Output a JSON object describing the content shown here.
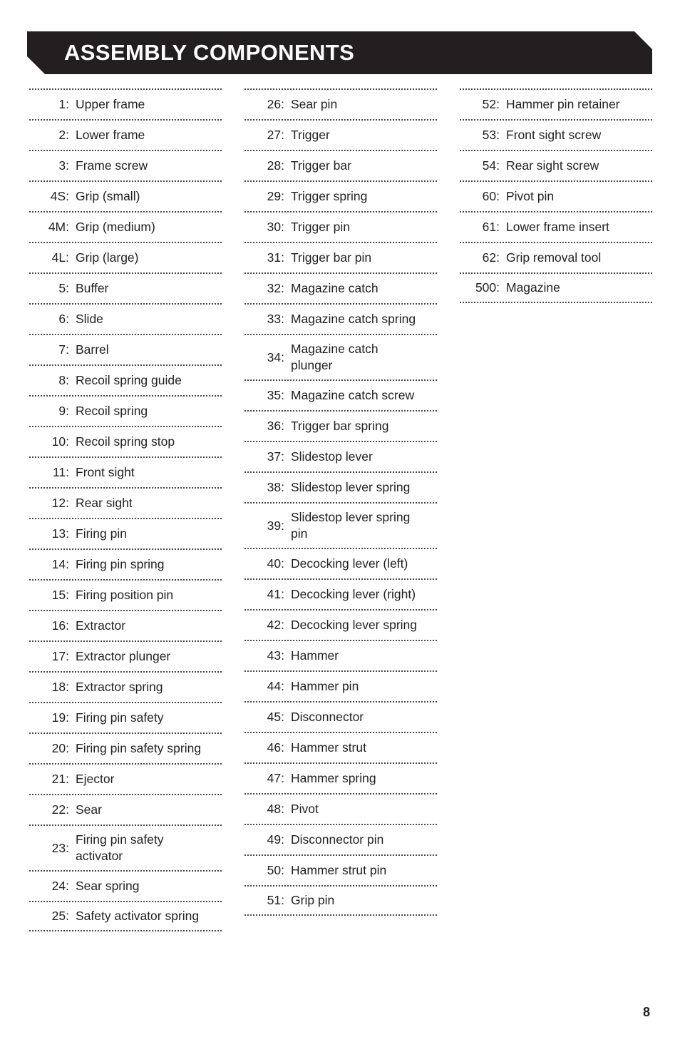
{
  "header": {
    "title": "ASSEMBLY COMPONENTS",
    "background_color": "#231f20",
    "text_color": "#ffffff"
  },
  "footer": {
    "page_number": "8"
  },
  "columns": [
    {
      "id": "column-1",
      "rows": [
        {
          "num": "1:",
          "label": "Upper frame"
        },
        {
          "num": "2:",
          "label": "Lower frame"
        },
        {
          "num": "3:",
          "label": "Frame screw"
        },
        {
          "num": "4S:",
          "label": "Grip (small)"
        },
        {
          "num": "4M:",
          "label": "Grip (medium)"
        },
        {
          "num": "4L:",
          "label": "Grip (large)"
        },
        {
          "num": "5:",
          "label": "Buffer"
        },
        {
          "num": "6:",
          "label": "Slide"
        },
        {
          "num": "7:",
          "label": "Barrel"
        },
        {
          "num": "8:",
          "label": "Recoil spring guide"
        },
        {
          "num": "9:",
          "label": "Recoil spring"
        },
        {
          "num": "10:",
          "label": "Recoil spring stop"
        },
        {
          "num": "11:",
          "label": "Front sight"
        },
        {
          "num": "12:",
          "label": "Rear sight"
        },
        {
          "num": "13:",
          "label": "Firing pin"
        },
        {
          "num": "14:",
          "label": "Firing pin spring"
        },
        {
          "num": "15:",
          "label": "Firing position pin"
        },
        {
          "num": "16:",
          "label": "Extractor"
        },
        {
          "num": "17:",
          "label": "Extractor plunger"
        },
        {
          "num": "18:",
          "label": "Extractor spring"
        },
        {
          "num": "19:",
          "label": "Firing pin safety"
        },
        {
          "num": "20:",
          "label": "Firing pin safety spring"
        },
        {
          "num": "21:",
          "label": "Ejector"
        },
        {
          "num": "22:",
          "label": "Sear"
        },
        {
          "num": "23:",
          "label": "Firing pin safety activator",
          "two_line": true
        },
        {
          "num": "24:",
          "label": "Sear spring"
        },
        {
          "num": "25:",
          "label": "Safety activator spring"
        }
      ]
    },
    {
      "id": "column-2",
      "rows": [
        {
          "num": "26:",
          "label": "Sear pin"
        },
        {
          "num": "27:",
          "label": "Trigger"
        },
        {
          "num": "28:",
          "label": "Trigger bar"
        },
        {
          "num": "29:",
          "label": "Trigger spring"
        },
        {
          "num": "30:",
          "label": "Trigger pin"
        },
        {
          "num": "31:",
          "label": "Trigger bar pin"
        },
        {
          "num": "32:",
          "label": "Magazine catch"
        },
        {
          "num": "33:",
          "label": "Magazine catch spring"
        },
        {
          "num": "34:",
          "label": "Magazine catch plunger",
          "two_line": true
        },
        {
          "num": "35:",
          "label": "Magazine catch screw"
        },
        {
          "num": "36:",
          "label": "Trigger bar spring"
        },
        {
          "num": "37:",
          "label": "Slidestop lever"
        },
        {
          "num": "38:",
          "label": "Slidestop lever spring"
        },
        {
          "num": "39:",
          "label": "Slidestop lever spring pin",
          "two_line": true
        },
        {
          "num": "40:",
          "label": "Decocking lever (left)"
        },
        {
          "num": "41:",
          "label": "Decocking lever (right)"
        },
        {
          "num": "42:",
          "label": "Decocking lever spring"
        },
        {
          "num": "43:",
          "label": "Hammer"
        },
        {
          "num": "44:",
          "label": "Hammer pin"
        },
        {
          "num": "45:",
          "label": "Disconnector"
        },
        {
          "num": "46:",
          "label": "Hammer strut"
        },
        {
          "num": "47:",
          "label": "Hammer spring"
        },
        {
          "num": "48:",
          "label": "Pivot"
        },
        {
          "num": "49:",
          "label": "Disconnector pin"
        },
        {
          "num": "50:",
          "label": "Hammer strut pin"
        },
        {
          "num": "51:",
          "label": "Grip pin"
        }
      ]
    },
    {
      "id": "column-3",
      "rows": [
        {
          "num": "52:",
          "label": "Hammer pin retainer"
        },
        {
          "num": "53:",
          "label": "Front sight screw"
        },
        {
          "num": "54:",
          "label": "Rear sight screw"
        },
        {
          "num": "60:",
          "label": "Pivot pin"
        },
        {
          "num": "61:",
          "label": "Lower frame insert"
        },
        {
          "num": "62:",
          "label": "Grip removal tool"
        },
        {
          "num": "500:",
          "label": "Magazine"
        }
      ]
    }
  ]
}
